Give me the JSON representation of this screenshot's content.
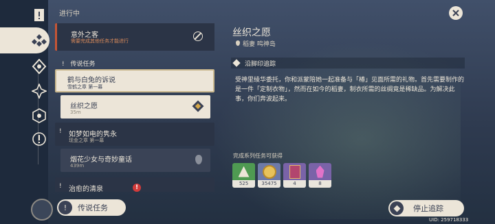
{
  "header": {
    "status_heading": "进行中"
  },
  "quest_list": {
    "top_quest": {
      "title": "意外之客",
      "subtitle": "需要完成其他任务才能进行"
    },
    "section_label": "传说任务",
    "quests": [
      {
        "title": "鹤与白兔的诉说",
        "subtitle": "雪鹤之章 第一幕"
      },
      {
        "title": "丝织之愿",
        "subtitle": "35m"
      },
      {
        "title": "如梦如电的隽永",
        "subtitle": "现金之章 第一幕"
      },
      {
        "title": "烟花少女与奇妙童话",
        "subtitle": "439m"
      },
      {
        "title": "治愈的清泉",
        "subtitle": ""
      }
    ]
  },
  "buttons": {
    "legend_quests": "传说任务",
    "stop_tracking": "停止追踪"
  },
  "detail": {
    "title": "丝织之愿",
    "location": "稻妻 鸣神岛",
    "step_label": "沿脚印追踪",
    "description": "受神里绫华委托，你和派蒙陪她一起准备与「椿」见面所需的礼物。首先需要制作的是一件「定制衣物」，然而在如今的稻妻，制衣所需的丝绸竟是稀缺品。为解决此事，你们奔波起来。",
    "rewards_label": "完成系列任务可获得",
    "rewards": [
      {
        "icon": "adventure-exp-icon",
        "count": "525",
        "color": "#4f9a52"
      },
      {
        "icon": "mora-coin-icon",
        "count": "35475",
        "color": "#6e7aa8"
      },
      {
        "icon": "book-icon",
        "count": "4",
        "color": "#7a63a8"
      },
      {
        "icon": "crystal-icon",
        "count": "8",
        "color": "#7a63a8"
      }
    ]
  },
  "footer": {
    "uid": "UID: 259718333"
  },
  "colors": {
    "panel": "#2b3446",
    "cream": "#ece5d8",
    "accent_gold": "#c9b78d",
    "badge_red": "#d23b3b"
  }
}
